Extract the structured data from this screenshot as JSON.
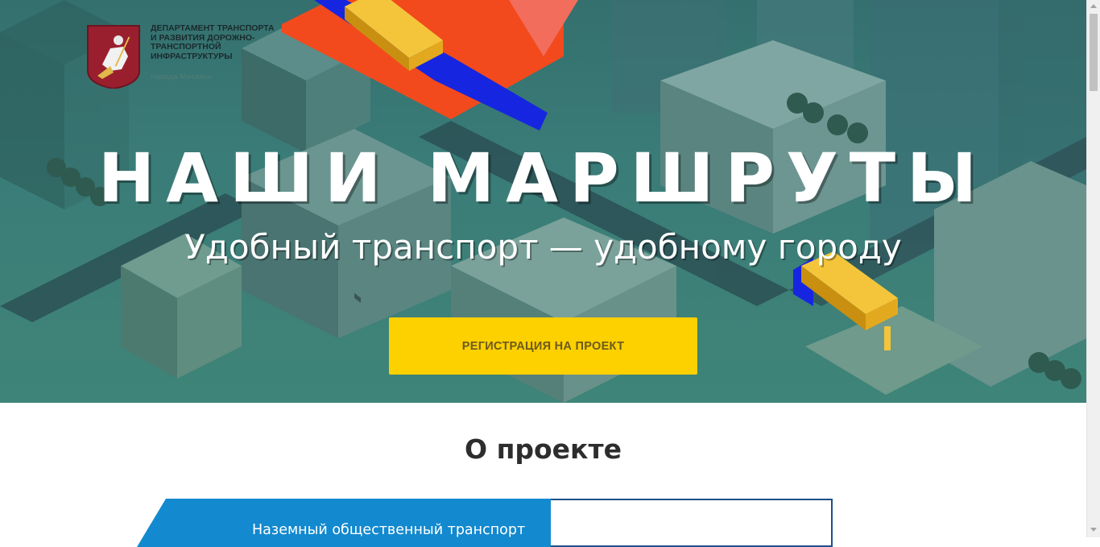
{
  "header": {
    "org_name_lines": [
      "Департамент транспорта",
      "и развития дорожно-",
      "транспортной",
      "инфраструктуры"
    ],
    "org_city": "города Москвы"
  },
  "hero": {
    "title": "НАШИ МАРШРУТЫ",
    "subtitle": "Удобный транспорт — удобному городу",
    "register_label": "РЕГИСТРАЦИЯ НА ПРОЕКТ"
  },
  "about": {
    "heading": "О проекте",
    "tabs": [
      {
        "label": "Наземный общественный транспорт",
        "active": true
      },
      {
        "label": "",
        "active": false
      }
    ]
  },
  "colors": {
    "accent_yellow": "#fdd000",
    "tab_blue": "#1389cf",
    "route_red": "#f24a1d",
    "route_blue": "#1626e0",
    "bus_yellow": "#f4c53a",
    "pin_coral": "#f26d5b"
  }
}
